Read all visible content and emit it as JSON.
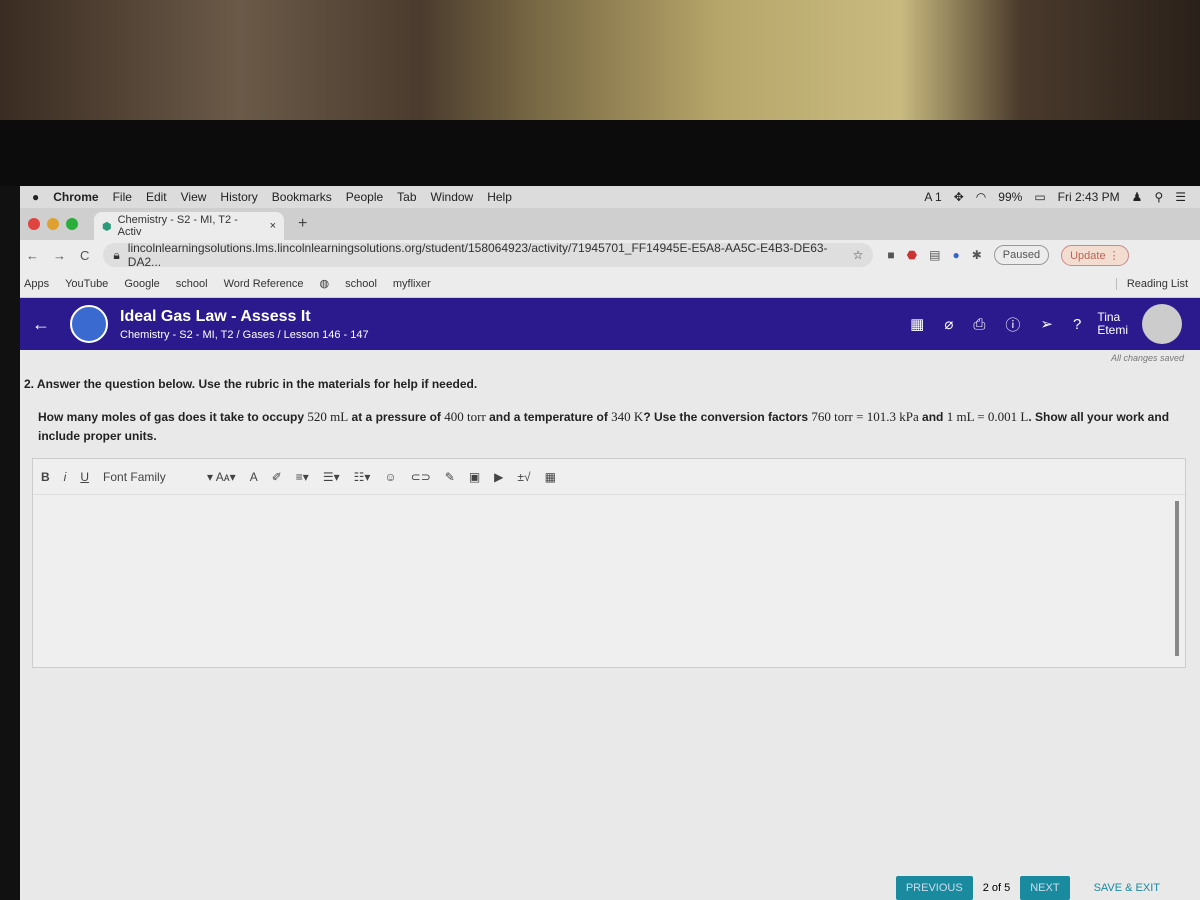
{
  "menubar": {
    "apple": "",
    "app": "Chrome",
    "items": [
      "File",
      "Edit",
      "View",
      "History",
      "Bookmarks",
      "People",
      "Tab",
      "Window",
      "Help"
    ],
    "adobe": "1",
    "battery": "99%",
    "clock": "Fri 2:43 PM"
  },
  "tab": {
    "title": "Chemistry - S2 - MI, T2 - Activ",
    "close": "×",
    "new": "+"
  },
  "address": {
    "url": "lincolnlearningsolutions.lms.lincolnlearningsolutions.org/student/158064923/activity/71945701_FF14945E-E5A8-AA5C-E4B3-DE63-DA2...",
    "paused": "Paused",
    "update": "Update ⋮"
  },
  "bookmarks": {
    "items": [
      "Apps",
      "YouTube",
      "Google",
      "school",
      "Word Reference",
      "school",
      "myflixer"
    ],
    "reading_list": "Reading List"
  },
  "header": {
    "title": "Ideal Gas Law - Assess It",
    "breadcrumb": "Chemistry - S2 - MI, T2 / Gases / Lesson 146 - 147",
    "user_first": "Tina",
    "user_last": "Etemi"
  },
  "status": {
    "saved": "All changes saved"
  },
  "question": {
    "instruction": "2. Answer the question below. Use the rubric in the materials for help if needed.",
    "p1": "How many moles of gas does it take to occupy ",
    "v1": "520 mL",
    "p2": " at a pressure of ",
    "v2": "400 torr",
    "p3": " and a temperature of ",
    "v3": "340 K",
    "p4": "? Use the conversion factors ",
    "v4": "760 torr = 101.3 kPa",
    "p5": " and ",
    "v5": "1 mL = 0.001 L",
    "p6": ". Show all your work and include proper units."
  },
  "editor": {
    "font_family": "Font Family",
    "answer": ""
  },
  "footer": {
    "previous": "PREVIOUS",
    "page": "2 of 5",
    "next": "NEXT",
    "save_exit": "SAVE & EXIT"
  },
  "colors": {
    "header": "#2b1a8e",
    "button": "#1a8a9e"
  }
}
